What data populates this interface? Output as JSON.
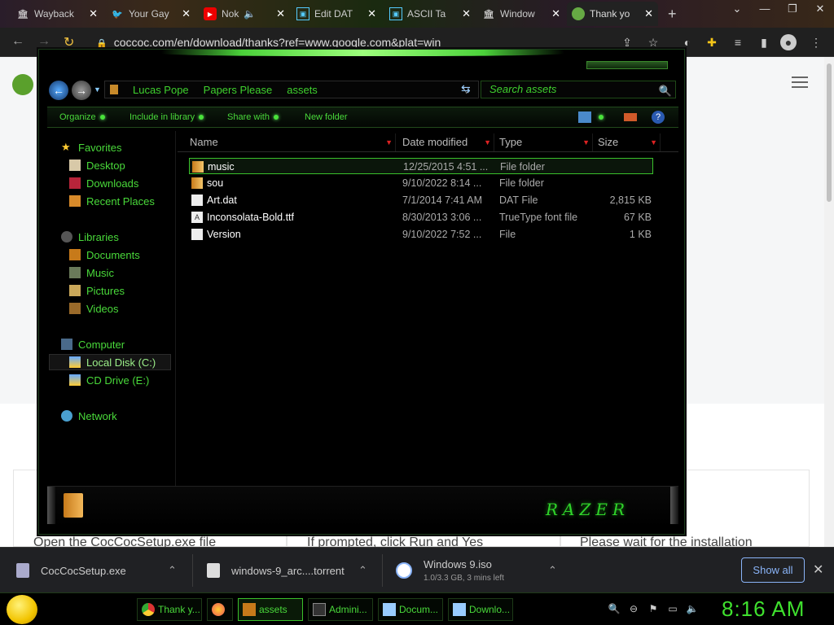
{
  "browser": {
    "tabs": [
      {
        "title": "Wayback",
        "icon": "archive-icon"
      },
      {
        "title": "Your Gay",
        "icon": "twitter-icon"
      },
      {
        "title": "Nok",
        "icon": "youtube-icon"
      },
      {
        "title": "Edit DAT",
        "icon": "page-icon"
      },
      {
        "title": "ASCII Ta",
        "icon": "page-icon"
      },
      {
        "title": "Window",
        "icon": "archive-icon"
      },
      {
        "title": "Thank yo",
        "icon": "coccoc-icon"
      }
    ],
    "new_tab": "+",
    "url": "coccoc.com/en/download/thanks?ref=www.google.com&plat=win"
  },
  "webpage": {
    "steps": [
      "Open the CocCocSetup.exe file",
      "If prompted, click Run and Yes",
      "Please wait for the installation"
    ]
  },
  "explorer": {
    "breadcrumbs": [
      "Lucas Pope",
      "Papers Please",
      "assets"
    ],
    "search_placeholder": "Search assets",
    "commands": [
      "Organize",
      "Include in library",
      "Share with",
      "New folder"
    ],
    "nav": {
      "favorites_header": "Favorites",
      "favorites": [
        "Desktop",
        "Downloads",
        "Recent Places"
      ],
      "libraries_header": "Libraries",
      "libraries": [
        "Documents",
        "Music",
        "Pictures",
        "Videos"
      ],
      "computer_header": "Computer",
      "drives": [
        "Local Disk (C:)",
        "CD Drive (E:)"
      ],
      "network": "Network"
    },
    "columns": [
      "Name",
      "Date modified",
      "Type",
      "Size"
    ],
    "files": [
      {
        "name": "music",
        "date": "12/25/2015 4:51 ...",
        "type": "File folder",
        "size": ""
      },
      {
        "name": "sou",
        "date": "9/10/2022 8:14 ...",
        "type": "File folder",
        "size": ""
      },
      {
        "name": "Art.dat",
        "date": "7/1/2014 7:41 AM",
        "type": "DAT File",
        "size": "2,815 KB"
      },
      {
        "name": "Inconsolata-Bold.ttf",
        "date": "8/30/2013 3:06 ...",
        "type": "TrueType font file",
        "size": "67 KB"
      },
      {
        "name": "Version",
        "date": "9/10/2022 7:52 ...",
        "type": "File",
        "size": "1 KB"
      }
    ],
    "brand": "RAZER"
  },
  "downloads": {
    "items": [
      {
        "name": "CocCocSetup.exe",
        "sub": ""
      },
      {
        "name": "windows-9_arc....torrent",
        "sub": ""
      },
      {
        "name": "Windows 9.iso",
        "sub": "1.0/3.3 GB, 3 mins left"
      }
    ],
    "show_all": "Show all"
  },
  "taskbar": {
    "items": [
      "Thank y...",
      "",
      "assets",
      "Admini...",
      "Docum...",
      "Downlo..."
    ],
    "clock": "8:16 AM"
  },
  "colors": {
    "accent_green": "#49d93a",
    "download_blue": "#8ab4f8"
  }
}
